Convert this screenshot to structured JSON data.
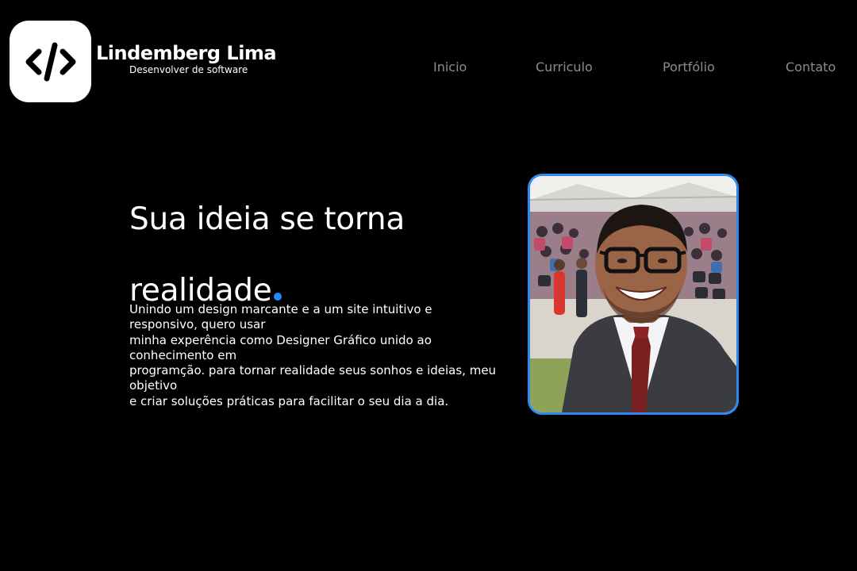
{
  "header": {
    "logo_icon": "code-brackets-icon",
    "brand_name": "Lindemberg Lima",
    "brand_subtitle": "Desenvolver de software",
    "nav": [
      {
        "label": "Inicio"
      },
      {
        "label": "Curriculo"
      },
      {
        "label": "Portfólio"
      },
      {
        "label": "Contato"
      }
    ]
  },
  "hero": {
    "title_line1": "Sua ideia se torna",
    "title_line2": "realidade",
    "description_lines": [
      "Unindo um design marcante e a um site intuitivo e",
      "responsivo, quero usar",
      "minha experência como Designer Gráfico unido ao",
      "conhecimento em",
      "programção. para tornar realidade seus sonhos e ideias, meu",
      "objetivo",
      "e criar soluções práticas para facilitar o seu dia a dia."
    ]
  },
  "colors": {
    "background": "#000000",
    "accent": "#1e8cff",
    "nav_text": "#8c8c8c",
    "photo_border": "#2a8cf0"
  }
}
